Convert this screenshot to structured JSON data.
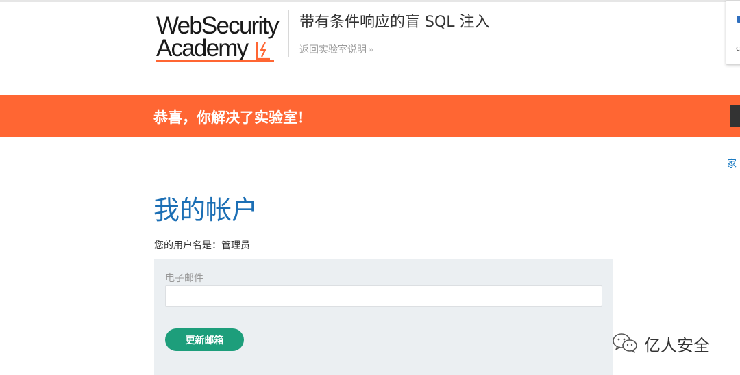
{
  "header": {
    "logo": {
      "line1": "WebSecurity",
      "line2": "Academy"
    },
    "lab_title": "带有条件响应的盲 SQL 注入",
    "back_link": "返回实验室说明",
    "back_chevron": "»"
  },
  "side_widget": {
    "letter": "c"
  },
  "banner": {
    "message": "恭喜，你解决了实验室！"
  },
  "nav": {
    "home": "家"
  },
  "main": {
    "title": "我的帐户",
    "username_line": "您的用户名是：管理员",
    "email_label": "电子邮件",
    "email_value": "",
    "update_button": "更新邮箱"
  },
  "watermark": {
    "text": "亿人安全"
  },
  "colors": {
    "accent_orange": "#ff6633",
    "title_blue": "#1c6fb5",
    "button_green": "#1d9e7b",
    "panel_gray": "#ebeff2"
  }
}
